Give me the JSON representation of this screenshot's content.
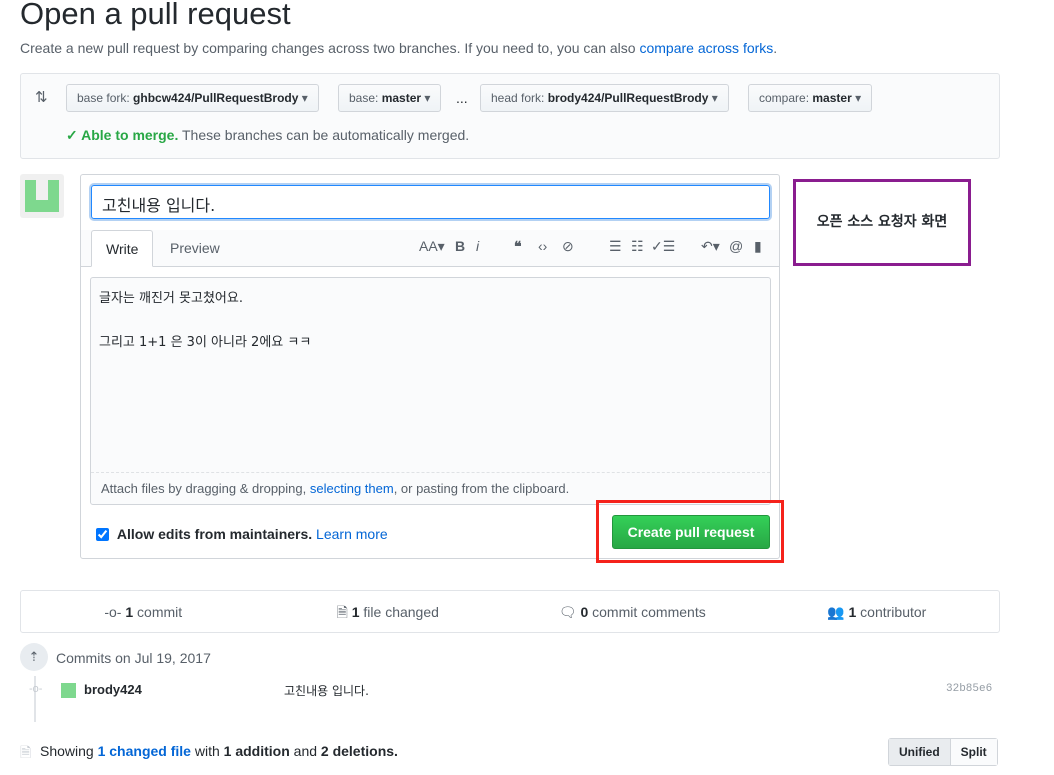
{
  "page": {
    "title": "Open a pull request",
    "subtitle": "Create a new pull request by comparing changes across two branches. If you need to, you can also ",
    "subtitle_link": "compare across forks",
    "subtitle_end": "."
  },
  "range": {
    "base_fork_label": "base fork:",
    "base_fork": "ghbcw424/PullRequestBrody",
    "base_label": "base:",
    "base": "master",
    "ellipsis": "...",
    "head_fork_label": "head fork:",
    "head_fork": "brody424/PullRequestBrody",
    "compare_label": "compare:",
    "compare": "master",
    "merge_status": "Able to merge.",
    "merge_message": " These branches can be automatically merged."
  },
  "form": {
    "title_value": "고친내용 입니다.",
    "tabs": [
      "Write",
      "Preview"
    ],
    "body": "글자는 깨진거 못고쳤어요.\n\n그리고 1+1 은 3이 아니라 2에요 ㅋㅋ",
    "attach_pre": "Attach files by dragging & dropping, ",
    "attach_link": "selecting them",
    "attach_post": ", or pasting from the clipboard.",
    "allow_edits": "Allow edits from maintainers.",
    "allow_edits_checked": true,
    "learn_more": "Learn more",
    "create_button": "Create pull request"
  },
  "annotation": "오픈 소스 요청자 화면",
  "stats": {
    "commits": "1",
    "commits_label": " commit",
    "files": "1",
    "files_label": " file changed",
    "comments": "0",
    "comments_label": " commit comments",
    "contributors": "1",
    "contributors_label": " contributor"
  },
  "commits": {
    "date_header": "Commits on Jul 19, 2017",
    "items": [
      {
        "author": "brody424",
        "message": "고친내용 입니다.",
        "sha": "32b85e6"
      }
    ]
  },
  "diff": {
    "showing": "Showing ",
    "changed_link": "1 changed file",
    "with": " with ",
    "additions": "1 addition",
    "and": " and ",
    "deletions": "2 deletions.",
    "views": [
      "Unified",
      "Split"
    ]
  },
  "colors": {
    "accent": "#0366d6",
    "success": "#28a745",
    "annotation_red": "#f5221b",
    "annotation_purple": "#8a1d8f"
  }
}
